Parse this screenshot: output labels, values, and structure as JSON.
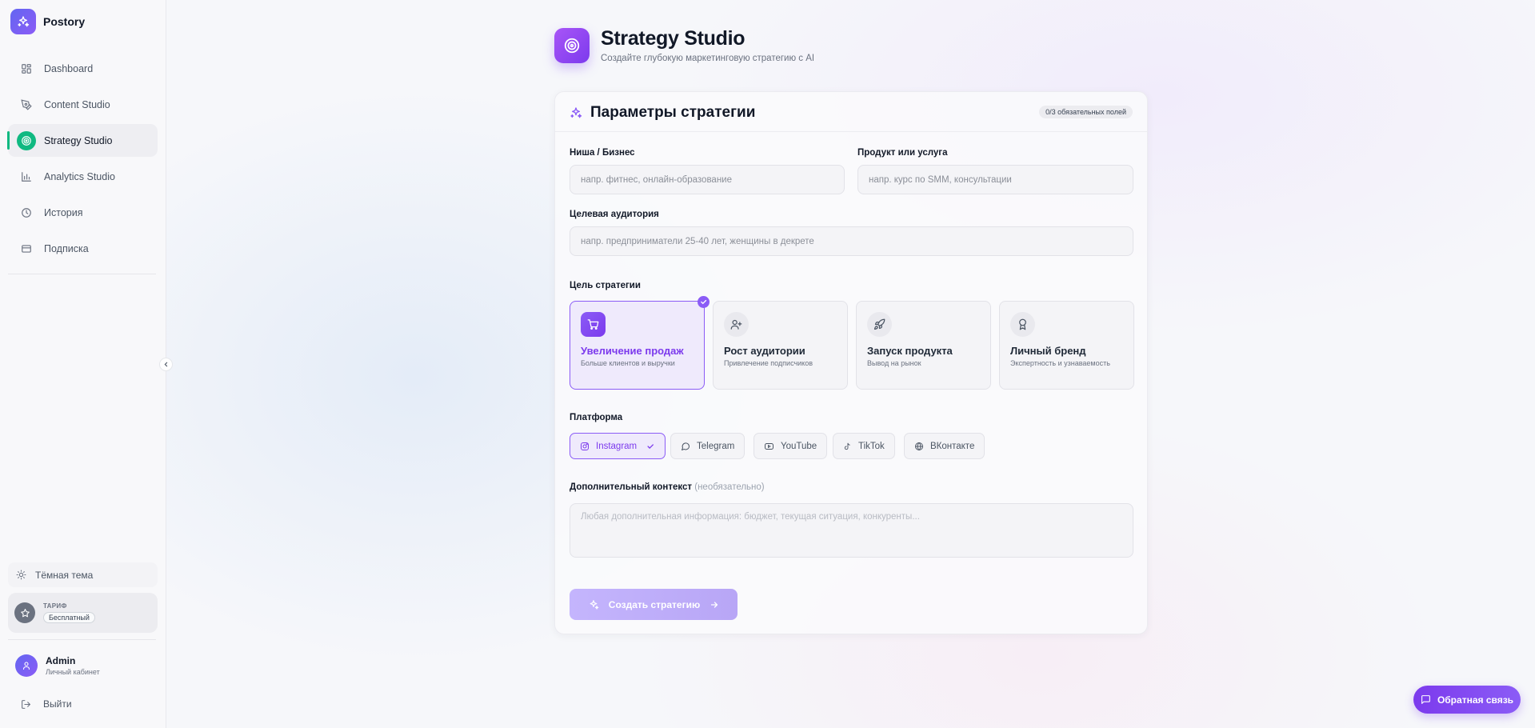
{
  "app": {
    "name": "Postory"
  },
  "sidebar": {
    "items": [
      {
        "label": "Dashboard",
        "icon": "grid-icon",
        "active": false
      },
      {
        "label": "Content Studio",
        "icon": "pen-icon",
        "active": false
      },
      {
        "label": "Strategy Studio",
        "icon": "target-icon",
        "active": true
      },
      {
        "label": "Analytics Studio",
        "icon": "bar-chart-icon",
        "active": false
      },
      {
        "label": "История",
        "icon": "clock-icon",
        "active": false
      },
      {
        "label": "Подписка",
        "icon": "card-icon",
        "active": false
      }
    ],
    "theme_toggle": "Тёмная тема",
    "plan": {
      "label": "ТАРИФ",
      "value": "Бесплатный"
    },
    "user": {
      "name": "Admin",
      "subtitle": "Личный кабинет"
    },
    "logout": "Выйти"
  },
  "header": {
    "title": "Strategy Studio",
    "subtitle": "Создайте глубокую маркетинговую стратегию с AI"
  },
  "form": {
    "title": "Параметры стратегии",
    "required_badge": "0/3 обязательных полей",
    "niche": {
      "label": "Ниша / Бизнес",
      "placeholder": "напр. фитнес, онлайн-образование",
      "value": ""
    },
    "product": {
      "label": "Продукт или услуга",
      "placeholder": "напр. курс по SMM, консультации",
      "value": ""
    },
    "audience": {
      "label": "Целевая аудитория",
      "placeholder": "напр. предприниматели 25-40 лет, женщины в декрете",
      "value": ""
    },
    "goal": {
      "label": "Цель стратегии",
      "options": [
        {
          "title": "Увеличение продаж",
          "subtitle": "Больше клиентов и выручки",
          "icon": "cart-icon",
          "selected": true
        },
        {
          "title": "Рост аудитории",
          "subtitle": "Привлечение подписчиков",
          "icon": "user-plus-icon",
          "selected": false
        },
        {
          "title": "Запуск продукта",
          "subtitle": "Вывод на рынок",
          "icon": "rocket-icon",
          "selected": false
        },
        {
          "title": "Личный бренд",
          "subtitle": "Экспертность и узнаваемость",
          "icon": "award-icon",
          "selected": false
        }
      ]
    },
    "platform": {
      "label": "Платформа",
      "options": [
        {
          "label": "Instagram",
          "icon": "instagram-icon",
          "selected": true
        },
        {
          "label": "Telegram",
          "icon": "chat-icon",
          "selected": false
        },
        {
          "label": "YouTube",
          "icon": "youtube-icon",
          "selected": false
        },
        {
          "label": "TikTok",
          "icon": "tiktok-icon",
          "selected": false
        },
        {
          "label": "ВКонтакте",
          "icon": "globe-icon",
          "selected": false
        }
      ]
    },
    "context": {
      "label": "Дополнительный контекст",
      "optional": "(необязательно)",
      "placeholder": "Любая дополнительная информация: бюджет, текущая ситуация, конкуренты...",
      "value": ""
    },
    "submit": "Создать стратегию"
  },
  "feedback_button": "Обратная связь",
  "colors": {
    "accent": "#8b5cf6",
    "active_nav": "#10b981",
    "brand": "#6366f1"
  }
}
